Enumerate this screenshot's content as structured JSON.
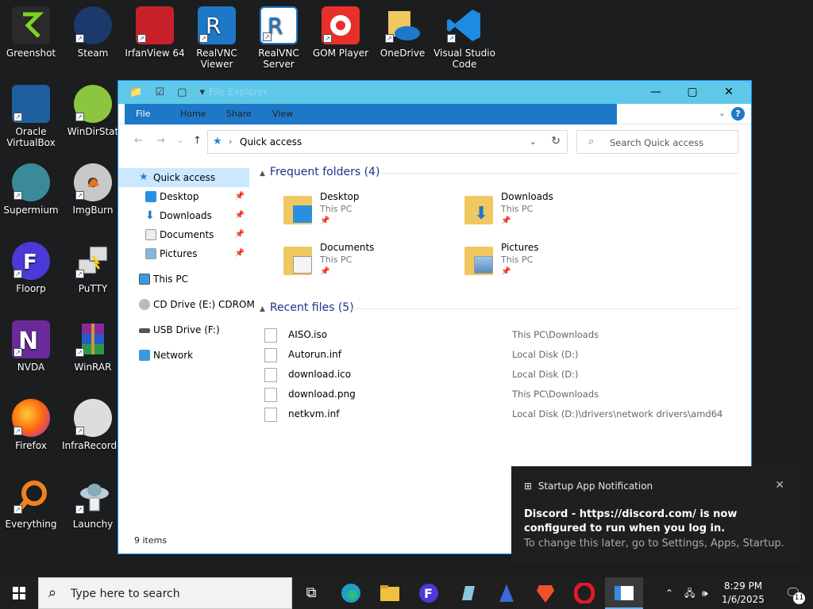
{
  "desktop": {
    "icons": [
      {
        "label": "Greenshot"
      },
      {
        "label": "Steam"
      },
      {
        "label": "IrfanView 64"
      },
      {
        "label": "RealVNC Viewer"
      },
      {
        "label": "RealVNC Server"
      },
      {
        "label": "GOM Player"
      },
      {
        "label": "OneDrive"
      },
      {
        "label": "Visual Studio Code"
      },
      {
        "label": "Oracle VirtualBox"
      },
      {
        "label": "WinDirStat"
      },
      {
        "label": "Supermium"
      },
      {
        "label": "ImgBurn"
      },
      {
        "label": "Floorp"
      },
      {
        "label": "PuTTY"
      },
      {
        "label": "NVDA"
      },
      {
        "label": "WinRAR"
      },
      {
        "label": "Firefox"
      },
      {
        "label": "InfraRecorder"
      },
      {
        "label": "Everything"
      },
      {
        "label": "Launchy"
      }
    ]
  },
  "explorer": {
    "title": "File Explorer",
    "ribbon_tabs": [
      "File",
      "Home",
      "Share",
      "View"
    ],
    "address": "Quick access",
    "search_placeholder": "Search Quick access",
    "nav": {
      "quick_access": "Quick access",
      "pinned": [
        "Desktop",
        "Downloads",
        "Documents",
        "Pictures"
      ],
      "this_pc": "This PC",
      "cd_drive": "CD Drive (E:) CDROM",
      "usb_drive": "USB Drive (F:)",
      "network": "Network"
    },
    "frequent_header": "Frequent folders (4)",
    "frequent": [
      {
        "name": "Desktop",
        "location": "This PC",
        "overlay": "#2a8fe0"
      },
      {
        "name": "Downloads",
        "location": "This PC",
        "overlay": "#1e78c8"
      },
      {
        "name": "Documents",
        "location": "This PC",
        "overlay": "#e8e8e8"
      },
      {
        "name": "Pictures",
        "location": "This PC",
        "overlay": "#7fb8e0"
      }
    ],
    "recent_header": "Recent files (5)",
    "recent": [
      {
        "name": "AISO.iso",
        "location": "This PC\\Downloads"
      },
      {
        "name": "Autorun.inf",
        "location": "Local Disk (D:)"
      },
      {
        "name": "download.ico",
        "location": "Local Disk (D:)"
      },
      {
        "name": "download.png",
        "location": "This PC\\Downloads"
      },
      {
        "name": "netkvm.inf",
        "location": "Local Disk (D:)\\drivers\\network drivers\\amd64"
      }
    ],
    "status": "9 items"
  },
  "toast": {
    "header": "Startup App Notification",
    "body": "Discord - https://discord.com/ is now configured to run when you log in.",
    "sub": "To change this later, go to Settings, Apps, Startup."
  },
  "taskbar": {
    "search_placeholder": "Type here to search",
    "time": "8:29 PM",
    "date": "1/6/2025",
    "notification_count": "11"
  }
}
